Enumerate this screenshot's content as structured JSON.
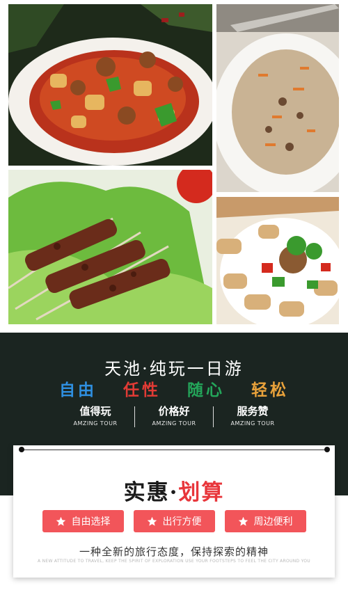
{
  "photos": [
    {
      "name": "braised-chicken-potatoes-photo"
    },
    {
      "name": "pilaf-rice-photo"
    },
    {
      "name": "lamb-skewers-photo"
    },
    {
      "name": "naan-stir-fry-photo"
    }
  ],
  "header": {
    "title": "天池·纯玩一日游",
    "slogans": [
      {
        "text": "自由",
        "color": "#2f8fe0"
      },
      {
        "text": "任性",
        "color": "#e23b35"
      },
      {
        "text": "随心",
        "color": "#24a55a"
      },
      {
        "text": "轻松",
        "color": "#e9a23b"
      }
    ],
    "stats": [
      {
        "title": "值得玩",
        "sub": "AMZING TOUR"
      },
      {
        "title": "价格好",
        "sub": "AMZING TOUR"
      },
      {
        "title": "服务赞",
        "sub": "AMZING TOUR"
      }
    ]
  },
  "card": {
    "title_part1": "实惠·",
    "title_part2": "划算",
    "title_color1": "#1a1a1a",
    "title_color2": "#e8363b",
    "features": [
      {
        "label": "自由选择",
        "icon": "star-icon"
      },
      {
        "label": "出行方便",
        "icon": "star-icon"
      },
      {
        "label": "周边便利",
        "icon": "star-icon"
      }
    ],
    "pill_color": "#f2555a",
    "tagline": "一种全新的旅行态度，保持探索的精神",
    "tagline_en": "A NEW ATTITUDE TO TRAVEL, KEEP THE SPIRIT OF EXPLORATION USE YOUR FOOTSTEPS TO FEEL THE CITY AROUND YOU"
  }
}
